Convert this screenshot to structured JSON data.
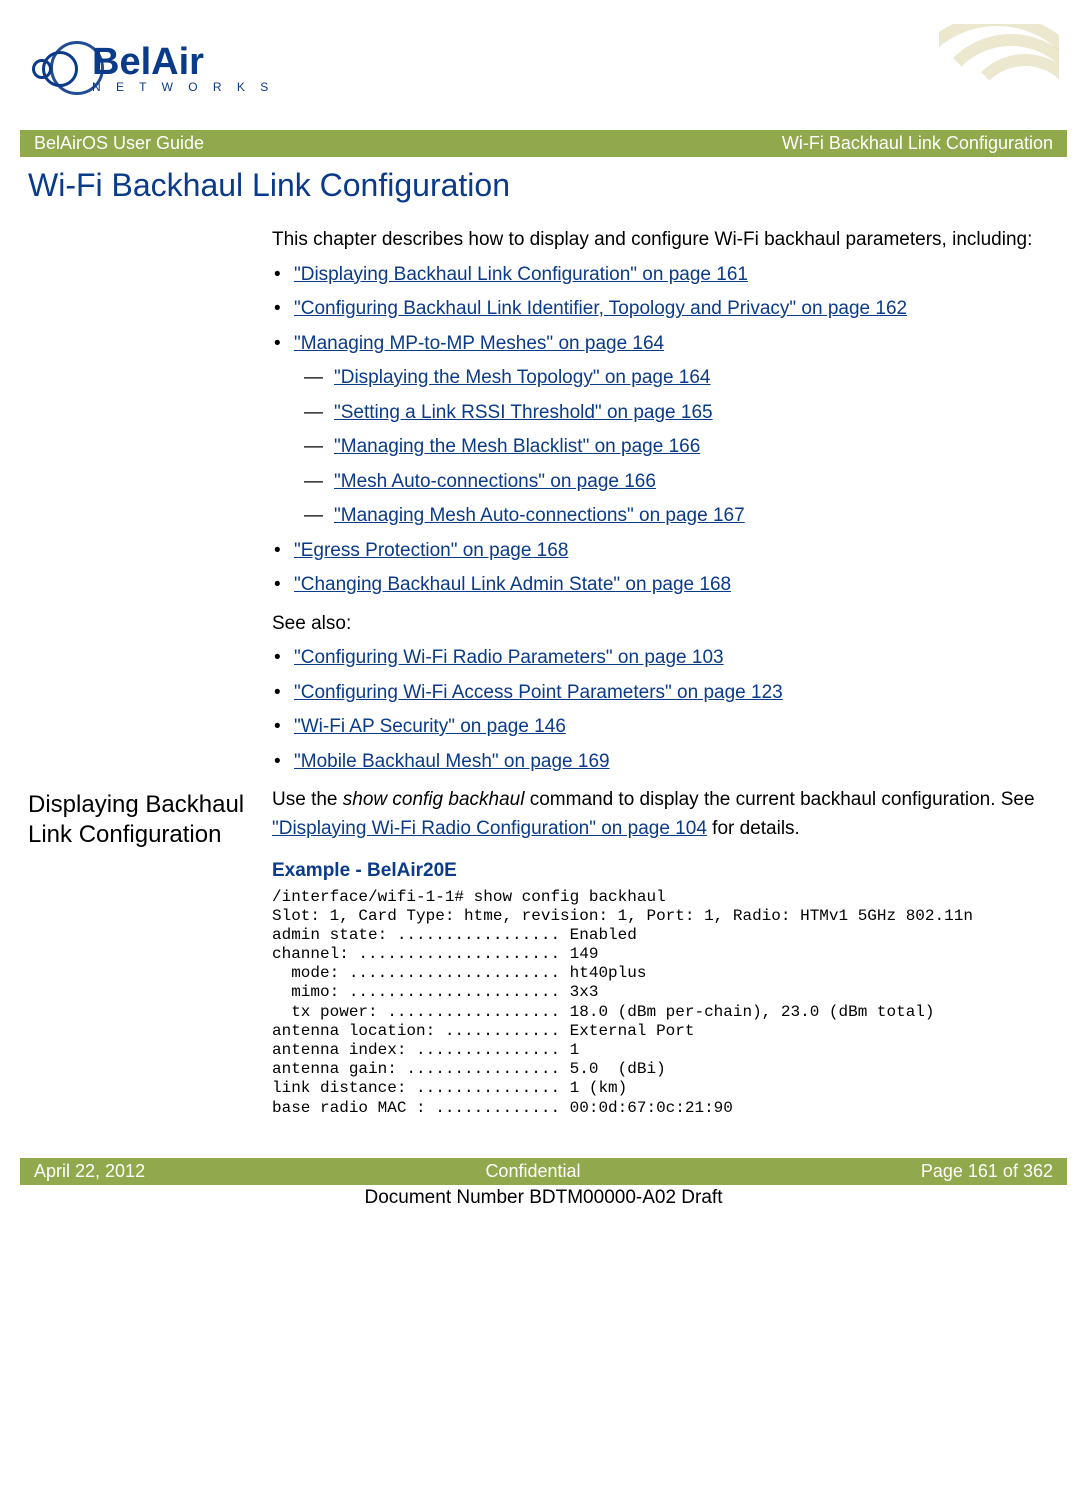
{
  "header": {
    "brand": "BelAir",
    "brand_tag": "N E T W O R K S",
    "bar_left": "BelAirOS User Guide",
    "bar_right": "Wi-Fi Backhaul Link Configuration"
  },
  "title": "Wi-Fi Backhaul Link Configuration",
  "intro": "This chapter describes how to display and configure Wi-Fi backhaul parameters, including:",
  "links": {
    "l1": "\"Displaying Backhaul Link Configuration\" on page 161",
    "l2": "\"Configuring Backhaul Link Identifier, Topology and Privacy\" on page 162",
    "l3": "\"Managing MP-to-MP Meshes\" on page 164",
    "l3a": "\"Displaying the Mesh Topology\" on page 164",
    "l3b": "\"Setting a Link RSSI Threshold\" on page 165",
    "l3c": "\"Managing the Mesh Blacklist\" on page 166",
    "l3d": "\"Mesh Auto-connections\" on page 166",
    "l3e": "\"Managing Mesh Auto-connections\" on page 167",
    "l4": "\"Egress Protection\" on page 168",
    "l5": "\"Changing Backhaul Link Admin State\" on page 168"
  },
  "see_also_label": "See also:",
  "see_also": {
    "s1": "\"Configuring Wi-Fi Radio Parameters\" on page 103",
    "s2": "\"Configuring Wi-Fi Access Point Parameters\" on page 123",
    "s3": "\"Wi-Fi AP Security\" on page 146",
    "s4": "\"Mobile Backhaul Mesh\" on page 169"
  },
  "section": {
    "heading": "Displaying Backhaul Link Configuration",
    "para_pre": "Use the ",
    "cmd": "show config backhaul",
    "para_mid": " command to display the current backhaul configuration. See ",
    "link": "\"Displaying Wi-Fi Radio Configuration\" on page 104",
    "para_post": " for details.",
    "example_title": "Example - BelAir20E",
    "terminal": "/interface/wifi-1-1# show config backhaul\nSlot: 1, Card Type: htme, revision: 1, Port: 1, Radio: HTMv1 5GHz 802.11n\nadmin state: ................. Enabled\nchannel: ..................... 149\n  mode: ...................... ht40plus\n  mimo: ...................... 3x3\n  tx power: .................. 18.0 (dBm per-chain), 23.0 (dBm total)\nantenna location: ............ External Port\nantenna index: ............... 1\nantenna gain: ................ 5.0  (dBi)\nlink distance: ............... 1 (km)\nbase radio MAC : ............. 00:0d:67:0c:21:90"
  },
  "footer": {
    "left": "April 22, 2012",
    "center": "Confidential",
    "right": "Page 161 of 362",
    "doc": "Document Number BDTM00000-A02 Draft"
  }
}
